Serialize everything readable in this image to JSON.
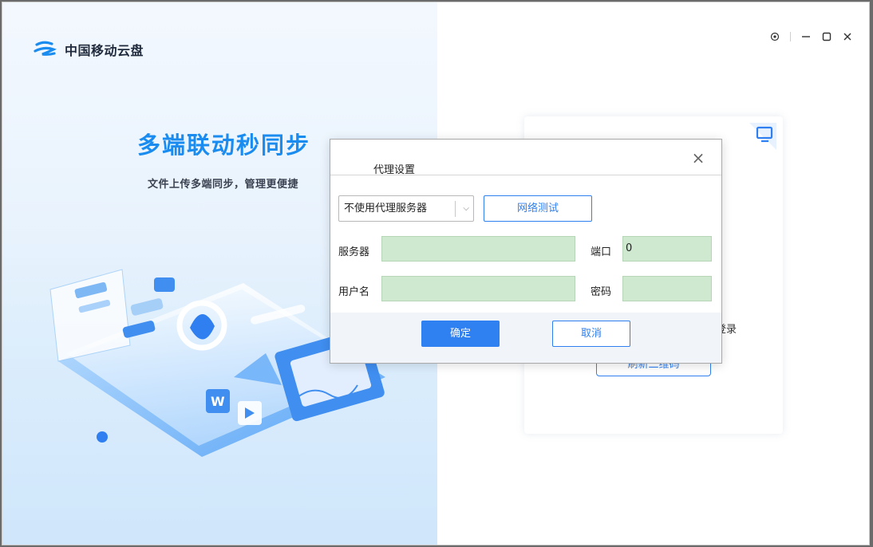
{
  "app": {
    "name": "中国移动云盘"
  },
  "hero": {
    "title": "多端联动秒同步",
    "subtitle": "文件上传多端同步，管理更便捷"
  },
  "window_controls": [
    "settings-icon",
    "minimize-icon",
    "maximize-icon",
    "close-icon"
  ],
  "qr": {
    "login_text": "登录",
    "refresh_label": "刷新二维码"
  },
  "dialog": {
    "title": "代理设置",
    "proxy_select": {
      "value": "不使用代理服务器"
    },
    "test_button": "网络测试",
    "server_label": "服务器",
    "server_value": "",
    "port_label": "端口",
    "port_value": "0",
    "username_label": "用户名",
    "username_value": "",
    "password_label": "密码",
    "password_value": "",
    "ok_label": "确定",
    "cancel_label": "取消"
  },
  "colors": {
    "brand": "#1a8cf0",
    "primary_button": "#2f80f0",
    "field_bg": "#cfe9d0"
  }
}
